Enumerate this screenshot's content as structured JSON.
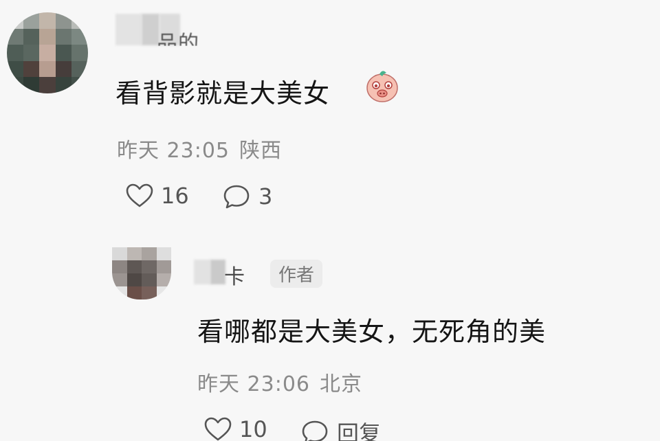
{
  "main_comment": {
    "username_tail": "品的",
    "text": "看背影就是大美女",
    "emoji": "pig-face-emoji",
    "time": "昨天 23:05",
    "location": "陕西",
    "likes": "16",
    "replies": "3"
  },
  "reply_comment": {
    "username_tail": "卡",
    "badge": "作者",
    "text": "看哪都是大美女，无死角的美",
    "time": "昨天 23:06",
    "location": "北京",
    "likes": "10",
    "reply_label": "回复"
  },
  "icons": {
    "like": "heart-icon",
    "comment": "comment-bubble-icon"
  },
  "colors": {
    "background": "#f7f7f7",
    "text": "#151515",
    "meta": "#8a8a8a",
    "badge_bg": "#ececec"
  }
}
